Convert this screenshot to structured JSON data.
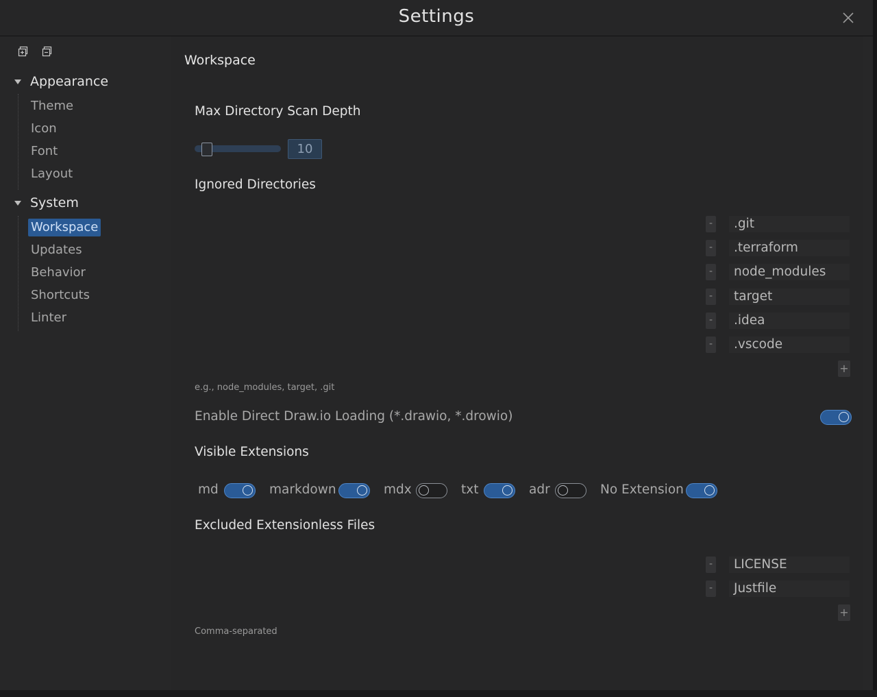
{
  "window": {
    "title": "Settings"
  },
  "sidebar": {
    "groups": [
      {
        "label": "Appearance",
        "items": [
          "Theme",
          "Icon",
          "Font",
          "Layout"
        ]
      },
      {
        "label": "System",
        "items": [
          "Workspace",
          "Updates",
          "Behavior",
          "Shortcuts",
          "Linter"
        ]
      }
    ],
    "active_item": "Workspace"
  },
  "content": {
    "section_title": "Workspace",
    "scan_depth": {
      "label": "Max Directory Scan Depth",
      "value": "10",
      "slider_fraction": 0.1
    },
    "ignored_dirs": {
      "label": "Ignored Directories",
      "items": [
        ".git",
        ".terraform",
        "node_modules",
        "target",
        ".idea",
        ".vscode"
      ],
      "hint": "e.g., node_modules, target, .git"
    },
    "drawio": {
      "label": "Enable Direct Draw.io Loading (*.drawio, *.drowio)",
      "enabled": true
    },
    "visible_ext": {
      "label": "Visible Extensions",
      "items": [
        {
          "name": "md",
          "on": true
        },
        {
          "name": "markdown",
          "on": true
        },
        {
          "name": "mdx",
          "on": false
        },
        {
          "name": "txt",
          "on": true
        },
        {
          "name": "adr",
          "on": false
        },
        {
          "name": "No Extension",
          "on": true
        }
      ]
    },
    "excluded_files": {
      "label": "Excluded Extensionless Files",
      "items": [
        "LICENSE",
        "Justfile"
      ],
      "hint": "Comma-separated"
    },
    "minus_glyph": "-",
    "plus_glyph": "+"
  },
  "colors": {
    "accent": "#2a5b97",
    "active_item_bg": "#2a5a94",
    "panel_bg": "#262627"
  }
}
